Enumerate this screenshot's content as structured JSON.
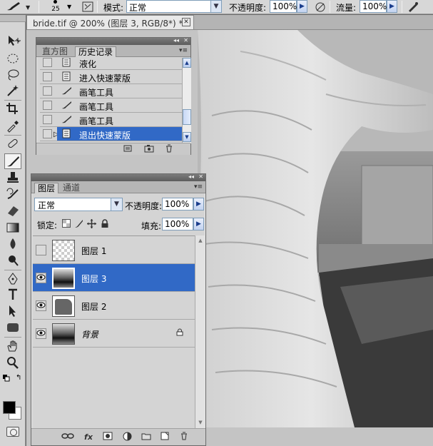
{
  "options_bar": {
    "brush_size": "25",
    "mode_label": "模式:",
    "mode_value": "正常",
    "opacity_label": "不透明度:",
    "opacity_value": "100%",
    "flow_label": "流量:",
    "flow_value": "100%"
  },
  "document": {
    "tab_title": "bride.tif @ 200% (图层 3, RGB/8*) *",
    "close_glyph": "✕"
  },
  "history_panel": {
    "tabs": [
      "直方图",
      "历史记录"
    ],
    "active_tab": "历史记录",
    "items": [
      {
        "label": "液化",
        "icon": "document-icon"
      },
      {
        "label": "进入快速蒙版",
        "icon": "document-icon"
      },
      {
        "label": "画笔工具",
        "icon": "brush-icon"
      },
      {
        "label": "画笔工具",
        "icon": "brush-icon"
      },
      {
        "label": "画笔工具",
        "icon": "brush-icon"
      },
      {
        "label": "退出快速蒙版",
        "icon": "document-icon",
        "selected": true
      }
    ]
  },
  "layers_panel": {
    "tabs": [
      "图层",
      "通道"
    ],
    "active_tab": "图层",
    "blend_mode": "正常",
    "opacity_label": "不透明度:",
    "opacity_value": "100%",
    "lock_label": "锁定:",
    "fill_label": "填充:",
    "fill_value": "100%",
    "layers": [
      {
        "name": "图层 1",
        "visible": false,
        "thumb": "transparent"
      },
      {
        "name": "图层 3",
        "visible": true,
        "thumb": "photo",
        "selected": true
      },
      {
        "name": "图层 2",
        "visible": true,
        "thumb": "gray-shape"
      },
      {
        "name": "背景",
        "visible": true,
        "thumb": "photo",
        "locked": true
      }
    ]
  },
  "colors": {
    "selection": "#3169c6",
    "panel_bg": "#d4d4d4",
    "foreground": "#000000",
    "background": "#ffffff"
  }
}
